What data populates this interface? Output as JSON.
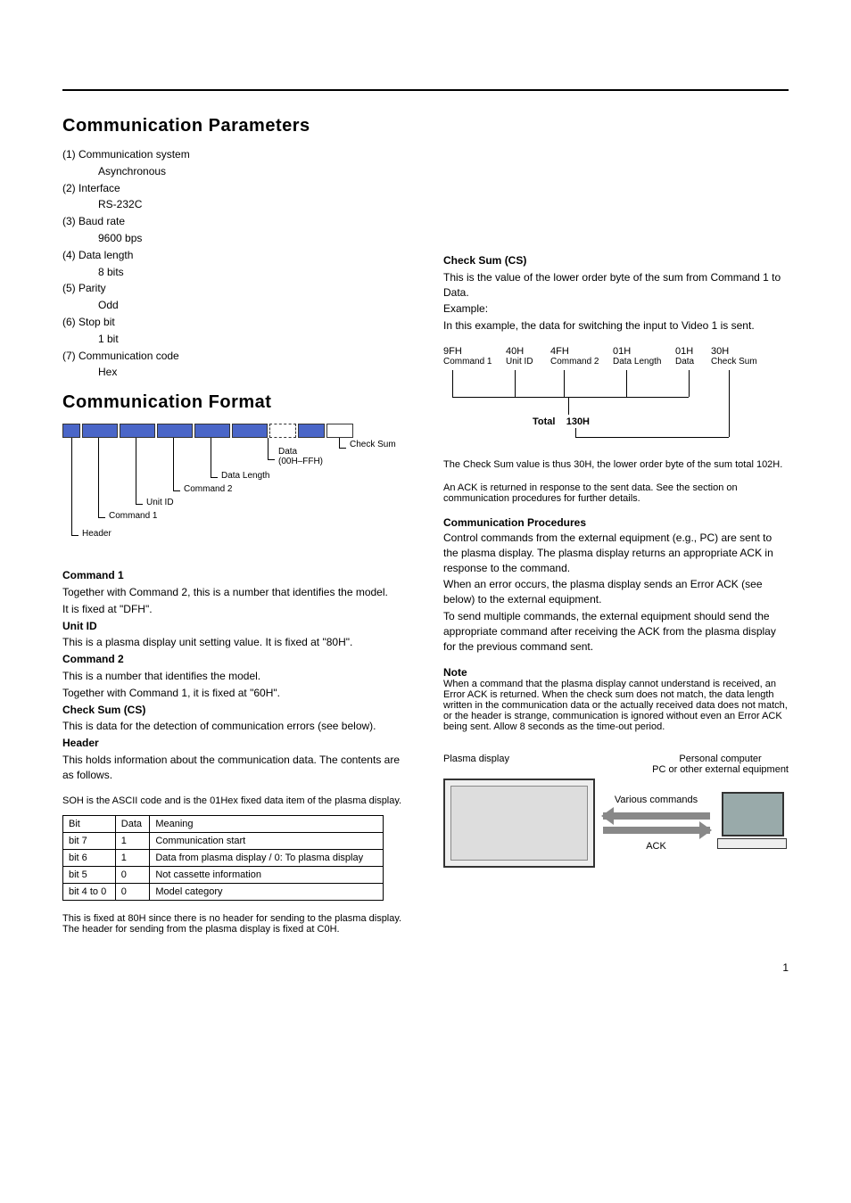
{
  "section1": {
    "heading": "Communication Parameters",
    "lines": [
      "(1) Communication system",
      "Asynchronous",
      "(2) Interface",
      "RS-232C",
      "(3) Baud rate",
      "9600 bps",
      "(4) Data length",
      "8 bits",
      "(5) Parity",
      "Odd",
      "(6) Stop bit",
      "1 bit",
      "(7) Communication code",
      "Hex"
    ]
  },
  "section2": {
    "heading": "Communication Format",
    "packet_labels": {
      "hdr": "Header",
      "cmd1": "Command 1",
      "unit": "Unit ID",
      "cmd2": "Command 2",
      "dlen": "Data Length",
      "data": "Data",
      "data2": "(00H‒FFH)",
      "cs": "Check Sum"
    },
    "body": [
      "Command 1",
      "Together with Command 2, this is a number that identifies the model.",
      "It is fixed at \"DFH\".",
      "Unit ID",
      "This is a plasma display unit setting value. It is fixed at \"80H\".",
      "Command 2",
      "This is a number that identifies the model.",
      "Together with Command 1, it is fixed at \"60H\".",
      "Check Sum (CS)",
      "This is data for the detection of communication errors (see below).",
      "Header",
      "This holds information about the communication data. The contents are as follows."
    ],
    "byte_row_text": "SOH is the ASCII code and is the 01Hex fixed data item of the plasma display.",
    "table": {
      "headers": [
        "Bit",
        "Data",
        "Meaning"
      ],
      "rows": [
        [
          "bit 7",
          "1",
          "Communication start"
        ],
        [
          "bit 6",
          "1",
          "Data from plasma display / 0: To plasma display"
        ],
        [
          "bit 5",
          "0",
          "Not cassette information"
        ],
        [
          "bit 4 to 0",
          "0",
          "Model category"
        ]
      ]
    },
    "notes": [
      "This is fixed at 80H since there is no header for sending to the plasma display.",
      "The header for sending from the plasma display is fixed at C0H."
    ]
  },
  "checksum_block": {
    "intro": "Check Sum (CS)",
    "desc": "This is the value of the lower order byte of the sum from Command 1 to Data.",
    "example_label": "Example:",
    "example": "In this example, the data for switching the input to Video 1 is sent.",
    "cols": [
      {
        "hex": "9FH",
        "lab": "Command 1"
      },
      {
        "hex": "40H",
        "lab": "Unit ID"
      },
      {
        "hex": "4FH",
        "lab": "Command 2"
      },
      {
        "hex": "01H",
        "lab": "Data Length"
      },
      {
        "hex": "01H",
        "lab": "Data"
      },
      {
        "hex": "30H",
        "lab": "Check Sum"
      }
    ],
    "total_label": "Total",
    "total_value": "130H",
    "total_note": "The Check Sum value is thus 30H, the lower order byte of the sum total 102H.",
    "ack": "An ACK is returned in response to the sent data. See the section on communication procedures for further details.",
    "comm_proc_heading": "Communication Procedures",
    "comm_proc_body": [
      "Control commands from the external equipment (e.g., PC) are sent to the plasma display. The plasma display returns an appropriate ACK in response to the command.",
      "When an error occurs, the plasma display sends an Error ACK (see below) to the external equipment.",
      "To send multiple commands, the external equipment should send the appropriate command after receiving the ACK from the plasma display for the previous command sent."
    ],
    "note_heading": "Note",
    "note_body": "When a command that the plasma display cannot understand is received, an Error ACK is returned. When the check sum does not match, the data length written in the communication data or the actually received data does not match, or the header is strange, communication is ignored without even an Error ACK being sent. Allow 8 seconds as the time-out period.",
    "diagram": {
      "plasma_label": "Plasma display",
      "pc_label1": "Personal computer",
      "pc_label2": "PC or other external equipment",
      "arrow1": "Various commands",
      "arrow2": "ACK"
    }
  },
  "page_number": "1"
}
